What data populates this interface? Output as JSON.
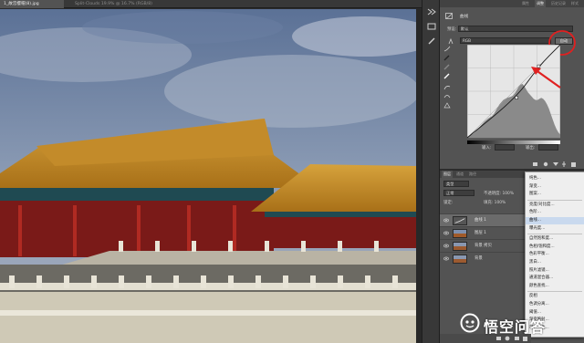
{
  "document": {
    "tabs": [
      {
        "label": "1_故宫樱帽(8).jpg",
        "active": true
      },
      {
        "label": "Split-Clouds 19.9% @ 16.7% (RGB/8)",
        "active": false
      }
    ]
  },
  "properties": {
    "tabs": [
      "属性",
      "调整",
      "历史记录",
      "样式"
    ],
    "title": "曲线",
    "preset_label": "预设:",
    "preset_value": "默认",
    "channel_value": "RGB",
    "auto_label": "自动",
    "input_label": "输入:",
    "output_label": "输出:",
    "curve_points": [
      [
        0,
        0
      ],
      [
        135,
        110
      ],
      [
        196,
        196
      ],
      [
        255,
        255
      ]
    ],
    "histogram": [
      2,
      3,
      5,
      7,
      10,
      14,
      18,
      22,
      26,
      30,
      33,
      36,
      38,
      40,
      44,
      50,
      56,
      62,
      66,
      70,
      72,
      74,
      75,
      76,
      78,
      82,
      88,
      94,
      98,
      100,
      96,
      90,
      84,
      80,
      76,
      72,
      70,
      70,
      72,
      74,
      72,
      68,
      62,
      54,
      44,
      34,
      24,
      16,
      10,
      6
    ]
  },
  "layers": {
    "tabs": [
      "图层",
      "通道",
      "路径"
    ],
    "kind_label": "类型",
    "blend_mode": "正常",
    "opacity_label": "不透明度: 100%",
    "lock_label": "锁定:",
    "fill_label": "填充: 100%",
    "items": [
      {
        "name": "曲线 1",
        "selected": true
      },
      {
        "name": "图层 1",
        "selected": false
      },
      {
        "name": "背景 拷贝",
        "selected": false
      },
      {
        "name": "背景",
        "selected": false
      }
    ]
  },
  "adjustment_menu": {
    "items": [
      {
        "label": "纯色...",
        "highlighted": false
      },
      {
        "label": "渐变...",
        "highlighted": false
      },
      {
        "label": "图案...",
        "highlighted": false
      },
      {
        "label": "亮度/对比度...",
        "highlighted": false,
        "sep_before": true
      },
      {
        "label": "色阶...",
        "highlighted": false
      },
      {
        "label": "曲线...",
        "highlighted": true
      },
      {
        "label": "曝光度...",
        "highlighted": false
      },
      {
        "label": "自然饱和度...",
        "highlighted": false,
        "sep_before": true
      },
      {
        "label": "色相/饱和度...",
        "highlighted": false
      },
      {
        "label": "色彩平衡...",
        "highlighted": false
      },
      {
        "label": "黑白...",
        "highlighted": false
      },
      {
        "label": "照片滤镜...",
        "highlighted": false
      },
      {
        "label": "通道混合器...",
        "highlighted": false
      },
      {
        "label": "颜色查找...",
        "highlighted": false
      },
      {
        "label": "反相",
        "highlighted": false,
        "sep_before": true
      },
      {
        "label": "色调分离...",
        "highlighted": false
      },
      {
        "label": "阈值...",
        "highlighted": false
      },
      {
        "label": "渐变映射...",
        "highlighted": false
      },
      {
        "label": "可选颜色...",
        "highlighted": false
      }
    ]
  },
  "watermark": {
    "text": "悟空问答"
  },
  "colors": {
    "annotation": "#e02020",
    "panel": "#535353",
    "menu_highlight": "#c9d9ee"
  }
}
